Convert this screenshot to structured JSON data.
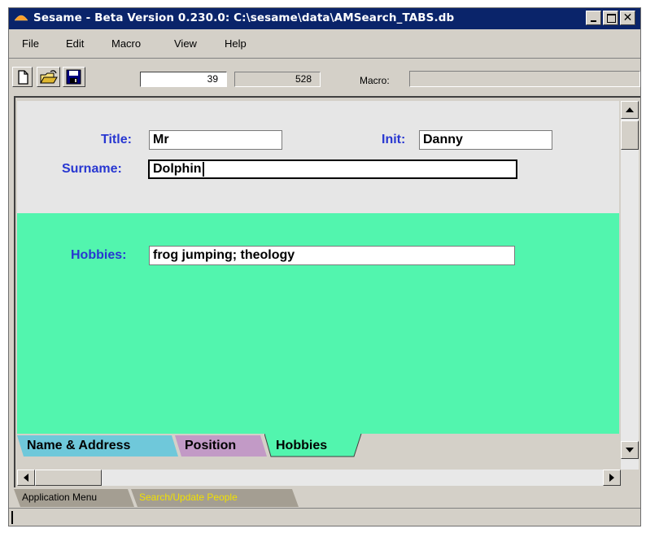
{
  "window": {
    "title": "Sesame - Beta Version 0.230.0: C:\\sesame\\data\\AMSearch_TABS.db",
    "close_glyph": "✕"
  },
  "menu": {
    "items": [
      {
        "label": "File"
      },
      {
        "label": "Edit"
      },
      {
        "label": "Macro"
      },
      {
        "label": "View"
      },
      {
        "label": "Help"
      }
    ]
  },
  "toolbar": {
    "icons": [
      "new-file-icon",
      "open-folder-icon",
      "save-disk-icon"
    ],
    "record_number": "39",
    "record_count": "528",
    "macro_label": "Macro:",
    "macro_value": ""
  },
  "form": {
    "title_label": "Title:",
    "title_value": "Mr",
    "init_label": "Init:",
    "init_value": "Danny",
    "surname_label": "Surname:",
    "surname_value": "Dolphin",
    "hobbies_label": "Hobbies:",
    "hobbies_value": "frog jumping; theology"
  },
  "tabs": [
    {
      "label": "Name & Address",
      "color": "#6fc8da"
    },
    {
      "label": "Position",
      "color": "#c29ac6"
    },
    {
      "label": "Hobbies",
      "color": "#52f5ae",
      "active": true
    }
  ],
  "app_tabs": [
    {
      "label": "Application Menu"
    },
    {
      "label": "Search/Update People",
      "active": true
    }
  ],
  "colors": {
    "title_bar": "#0a246a",
    "label_blue": "#2837d1",
    "form_top_bg": "#e6e6e6",
    "form_green_bg": "#52f5ae"
  }
}
